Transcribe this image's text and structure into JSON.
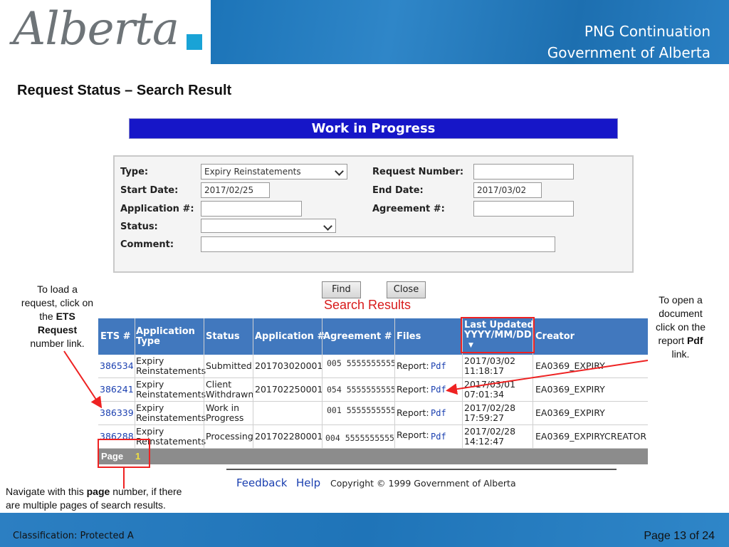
{
  "header": {
    "logo_text": "Alberta",
    "banner_line1": "PNG Continuation",
    "banner_line2": "Government of Alberta"
  },
  "slide_title": "Request Status – Search Result",
  "form": {
    "bar_title": "Work in Progress",
    "type_label": "Type:",
    "type_value": "Expiry Reinstatements",
    "request_number_label": "Request Number:",
    "request_number_value": "",
    "start_date_label": "Start Date:",
    "start_date_value": "2017/02/25",
    "end_date_label": "End Date:",
    "end_date_value": "2017/03/02",
    "application_label": "Application #:",
    "application_value": "",
    "agreement_label": "Agreement #:",
    "agreement_value": "",
    "status_label": "Status:",
    "status_value": "",
    "comment_label": "Comment:",
    "comment_value": "",
    "find_label": "Find",
    "close_label": "Close"
  },
  "search_results_label": "Search Results",
  "table": {
    "headers": {
      "ets": "ETS #",
      "app_type_1": "Application",
      "app_type_2": "Type",
      "status": "Status",
      "application": "Application #",
      "agreement": "Agreement #",
      "files": "Files",
      "updated_1": "Last Updated",
      "updated_2": "YYYY/MM/DD",
      "creator": "Creator"
    },
    "rows": [
      {
        "ets": "386534",
        "type1": "Expiry",
        "type2": "Reinstatements",
        "status1": "Submitted",
        "status2": "",
        "application": "201703020001",
        "agreement": "005 5555555555",
        "report": "Report:",
        "pdf": "Pdf",
        "date": "2017/03/02",
        "time": "11:18:17",
        "creator": "EA0369_EXPIRY"
      },
      {
        "ets": "386241",
        "type1": "Expiry",
        "type2": "Reinstatements",
        "status1": "Client",
        "status2": "Withdrawn",
        "application": "201702250001",
        "agreement": "054 5555555555",
        "report": "Report:",
        "pdf": "Pdf",
        "date": "2017/03/01",
        "time": "07:01:34",
        "creator": "EA0369_EXPIRY"
      },
      {
        "ets": "386339",
        "type1": "Expiry",
        "type2": "Reinstatements",
        "status1": "Work in",
        "status2": "Progress",
        "application": "",
        "agreement": "001 5555555555",
        "report": "Report:",
        "pdf": "Pdf",
        "date": "2017/02/28",
        "time": "17:59:27",
        "creator": "EA0369_EXPIRY"
      },
      {
        "ets": "386288",
        "type1": "Expiry",
        "type2": "Reinstatements",
        "status1": "Processing",
        "status2": "",
        "application": "201702280001",
        "agreement": "004 5555555555",
        "report": "Report:",
        "pdf": "Pdf",
        "date": "2017/02/28",
        "time": "14:12:47",
        "creator": "EA0369_EXPIRYCREATOR"
      }
    ],
    "page_label": "Page",
    "page_number": "1"
  },
  "web_footer": {
    "feedback": "Feedback",
    "help": "Help",
    "copyright": "Copyright © 1999 Government of Alberta"
  },
  "annotations": {
    "left_1": "To load a",
    "left_2": "request, click on",
    "left_3": "the",
    "left_3b": "ETS",
    "left_4": "Request",
    "left_5": "number link.",
    "right_1": "To open a",
    "right_2": "document",
    "right_3": "click on the",
    "right_4": "report",
    "right_4b": "Pdf",
    "right_5": "link.",
    "bottom_1": "Navigate with this",
    "bottom_1b": "page",
    "bottom_1c": "number, if there",
    "bottom_2": "are multiple pages of search results."
  },
  "footer": {
    "classification": "Classification: Protected A",
    "page_indicator": "Page 13 of 24"
  },
  "colors": {
    "banner_blue": "#1c74b8",
    "wip_bar": "#1616c8",
    "table_header": "#4178be",
    "annotation_red": "#e22222",
    "logo_accent": "#19a3d6"
  }
}
